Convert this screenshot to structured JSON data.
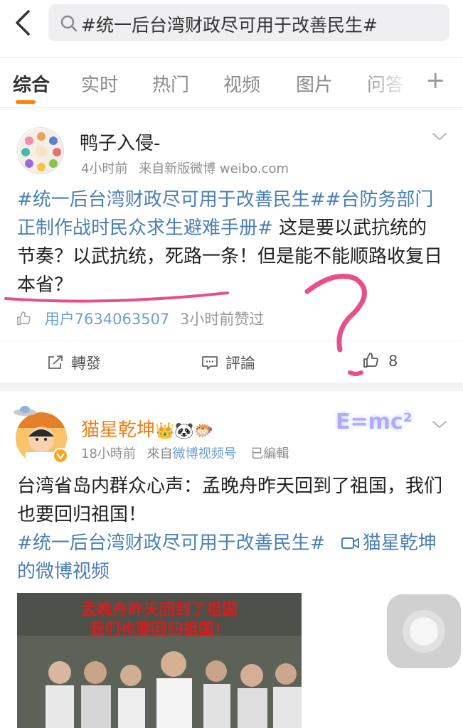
{
  "search": {
    "query": "#统一后台湾财政尽可用于改善民生#"
  },
  "tabs": [
    {
      "label": "综合"
    },
    {
      "label": "实时"
    },
    {
      "label": "热门"
    },
    {
      "label": "视频"
    },
    {
      "label": "图片"
    },
    {
      "label": "问答"
    }
  ],
  "colors": {
    "accent": "#ff8200",
    "tag": "#4a7fb5",
    "annotation": "#e6508a"
  },
  "posts": [
    {
      "author": "鸭子入侵-",
      "time": "4小时前",
      "source": "来自新版微博 weibo.com",
      "text_tag": "#统一后台湾财政尽可用于改善民生##台防务部门正制作战时民众求生避难手册#",
      "text_body": " 这是要以武抗统的节奏？以武抗统，死路一条！但是能不能顺路收复日本省？",
      "liked_by": "用户7634063507",
      "liked_time": "3小时前赞过",
      "repost_label": "轉發",
      "comment_label": "評論",
      "like_count": "8"
    },
    {
      "author": "猫星乾坤",
      "badge_emoji": "👑🐼🐡",
      "time": "18小時前",
      "source_prefix": "來自",
      "source": "微博视频号",
      "edited": "已編輯",
      "text_body": "台湾省岛内群众心声：孟晚舟昨天回到了祖国，我们也要回归祖国！",
      "text_tag": "#统一后台湾财政尽可用于改善民生#",
      "video_link": "猫星乾坤的微博视频",
      "video_caption_1": "孟晚舟昨天回到了祖国",
      "video_caption_2": "我们也要回归祖国！",
      "sticker_text": "E=mc²"
    }
  ]
}
